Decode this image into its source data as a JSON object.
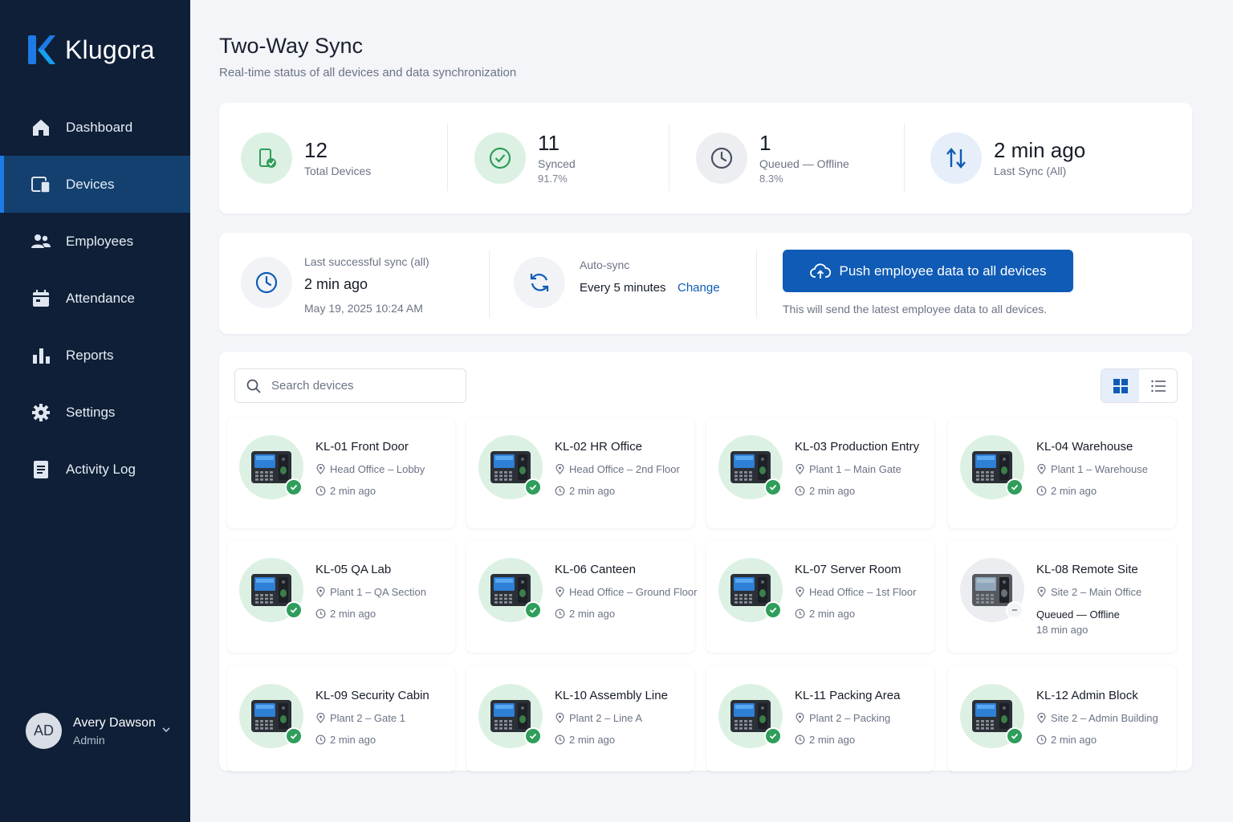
{
  "brand": {
    "name": "Klugora",
    "accent": "#1e7be6"
  },
  "nav": [
    {
      "label": "Dashboard",
      "icon": "home-icon"
    },
    {
      "label": "Devices",
      "icon": "devices-icon",
      "active": true
    },
    {
      "label": "Employees",
      "icon": "users-icon"
    },
    {
      "label": "Attendance",
      "icon": "calendar-icon"
    },
    {
      "label": "Reports",
      "icon": "bar-chart-icon"
    },
    {
      "label": "Settings",
      "icon": "gear-icon"
    },
    {
      "label": "Activity Log",
      "icon": "document-icon"
    }
  ],
  "user": {
    "initials": "AD",
    "name": "Avery Dawson",
    "role": "Admin"
  },
  "page": {
    "title": "Two-Way Sync",
    "subtitle": "Real-time status of all devices and data synchronization"
  },
  "stats": [
    {
      "value": "12",
      "label": "Total Devices",
      "sub": "",
      "icon": "device-check-icon",
      "color": "#2f9e5b"
    },
    {
      "value": "11",
      "label": "Synced",
      "sub": "91.7%",
      "icon": "check-circle-icon",
      "color": "#2f9e5b"
    },
    {
      "value": "1",
      "label": "Queued — Offline",
      "sub": "8.3%",
      "icon": "clock-icon",
      "color": "#4a5263"
    },
    {
      "value": "2 min ago",
      "label": "Last Sync (All)",
      "sub": "",
      "icon": "sync-arrows-icon",
      "color": "#0f5bb5"
    }
  ],
  "last_sync": {
    "label": "Last successful sync (all)",
    "value": "2 min ago",
    "date": "May 19, 2025 10:24 AM"
  },
  "auto_sync": {
    "label": "Auto-sync",
    "value": "Every 5 minutes",
    "change_label": "Change"
  },
  "push": {
    "button_label": "Push employee data to all devices",
    "note": "This will send the latest employee data to all devices."
  },
  "search": {
    "placeholder": "Search devices"
  },
  "view_toggle": {
    "active": "grid"
  },
  "devices": [
    {
      "name": "KL-01 Front Door",
      "location": "Head Office – Lobby",
      "status": "synced",
      "time": "2 min ago"
    },
    {
      "name": "KL-02 HR Office",
      "location": "Head Office – 2nd Floor",
      "status": "synced",
      "time": "2 min ago"
    },
    {
      "name": "KL-03 Production Entry",
      "location": "Plant 1 – Main Gate",
      "status": "synced",
      "time": "2 min ago"
    },
    {
      "name": "KL-04 Warehouse",
      "location": "Plant 1 – Warehouse",
      "status": "synced",
      "time": "2 min ago"
    },
    {
      "name": "KL-05 QA Lab",
      "location": "Plant 1 – QA Section",
      "status": "synced",
      "time": "2 min ago"
    },
    {
      "name": "KL-06 Canteen",
      "location": "Head Office – Ground Floor",
      "status": "synced",
      "time": "2 min ago"
    },
    {
      "name": "KL-07 Server Room",
      "location": "Head Office – 1st Floor",
      "status": "synced",
      "time": "2 min ago"
    },
    {
      "name": "KL-08 Remote Site",
      "location": "Site 2 – Main Office",
      "status": "queued",
      "status_label": "Queued — Offline",
      "time": "18 min ago"
    },
    {
      "name": "KL-09 Security Cabin",
      "location": "Plant 2 – Gate 1",
      "status": "synced",
      "time": "2 min ago"
    },
    {
      "name": "KL-10 Assembly Line",
      "location": "Plant 2 – Line A",
      "status": "synced",
      "time": "2 min ago"
    },
    {
      "name": "KL-11 Packing Area",
      "location": "Plant 2 – Packing",
      "status": "synced",
      "time": "2 min ago"
    },
    {
      "name": "KL-12 Admin Block",
      "location": "Site 2 – Admin Building",
      "status": "synced",
      "time": "2 min ago"
    }
  ],
  "colors": {
    "sidebar": "#0e1f37",
    "primary": "#0f5bb5",
    "success": "#2f9e5b",
    "success_bg": "#dcf1e3",
    "muted_bg": "#ebedf0"
  }
}
